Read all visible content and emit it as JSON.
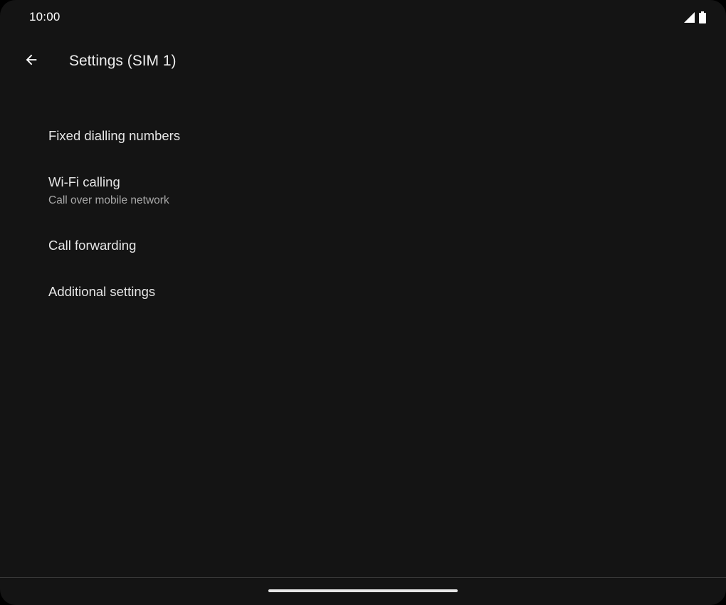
{
  "status_bar": {
    "time": "10:00",
    "icons": [
      "signal-icon",
      "battery-icon"
    ]
  },
  "app_bar": {
    "back_icon": "arrow-back-icon",
    "title": "Settings (SIM 1)"
  },
  "settings": {
    "items": [
      {
        "title": "Fixed dialling numbers"
      },
      {
        "title": "Wi-Fi calling",
        "summary": "Call over mobile network"
      },
      {
        "title": "Call forwarding"
      },
      {
        "title": "Additional settings"
      }
    ]
  },
  "colors": {
    "background": "#141414",
    "text_primary": "#e6e6e6",
    "text_secondary": "#a9a9a9"
  }
}
